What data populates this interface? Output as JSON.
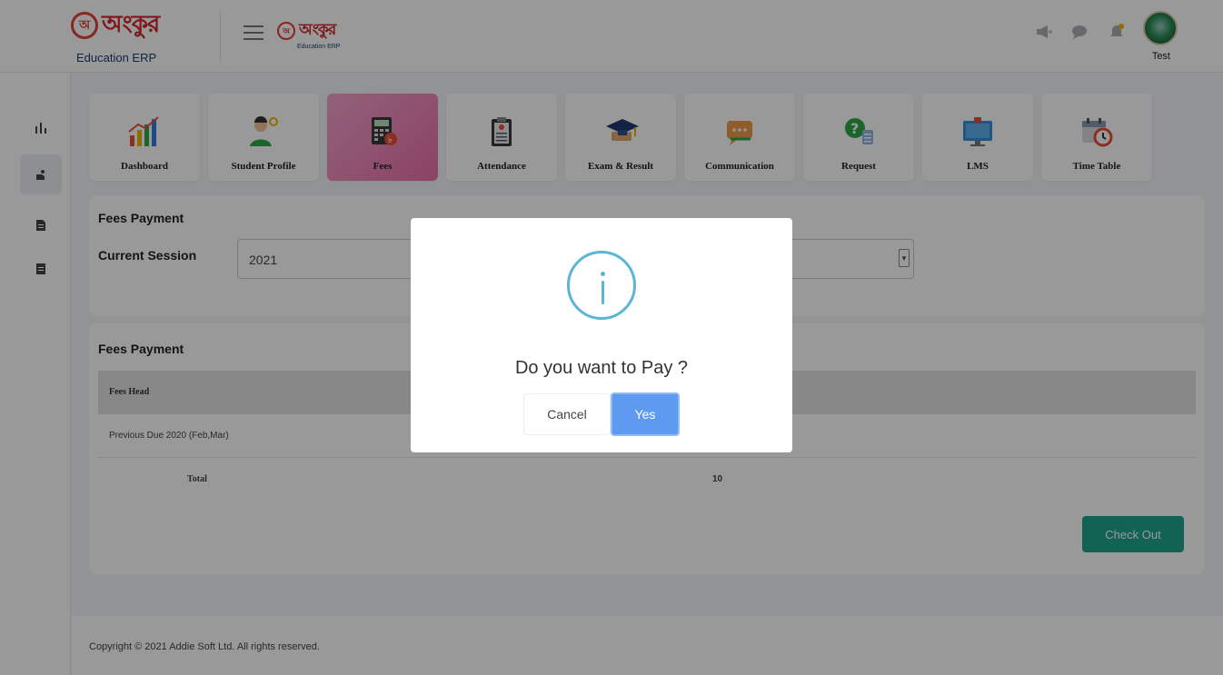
{
  "header": {
    "logo_text": "অংকুর",
    "logo_sub": "Education ERP",
    "small_logo_text": "অংকুর",
    "small_logo_sub": "Education ERP",
    "user_name": "Test"
  },
  "tiles": [
    {
      "label": "Dashboard"
    },
    {
      "label": "Student Profile"
    },
    {
      "label": "Fees"
    },
    {
      "label": "Attendance"
    },
    {
      "label": "Exam & Result"
    },
    {
      "label": "Communication"
    },
    {
      "label": "Request"
    },
    {
      "label": "LMS"
    },
    {
      "label": "Time Table"
    }
  ],
  "session_card": {
    "title": "Fees Payment",
    "session_label": "Current Session",
    "session_value": "2021"
  },
  "payment_card": {
    "title": "Fees Payment",
    "column_fees_head": "Fees Head",
    "row_label": "Previous Due 2020 (Feb,Mar)",
    "total_label": "Total",
    "total_value": "10",
    "checkout_label": "Check Out"
  },
  "footer": {
    "copyright": "Copyright © 2021 Addie Soft Ltd. All rights reserved."
  },
  "modal": {
    "question": "Do you want to Pay ?",
    "cancel_label": "Cancel",
    "yes_label": "Yes"
  },
  "colors": {
    "accent_pink": "#ea6fa9",
    "checkout_green": "#1fa58c",
    "yes_blue": "#5e9bf0",
    "info_icon": "#5bb5d6"
  }
}
